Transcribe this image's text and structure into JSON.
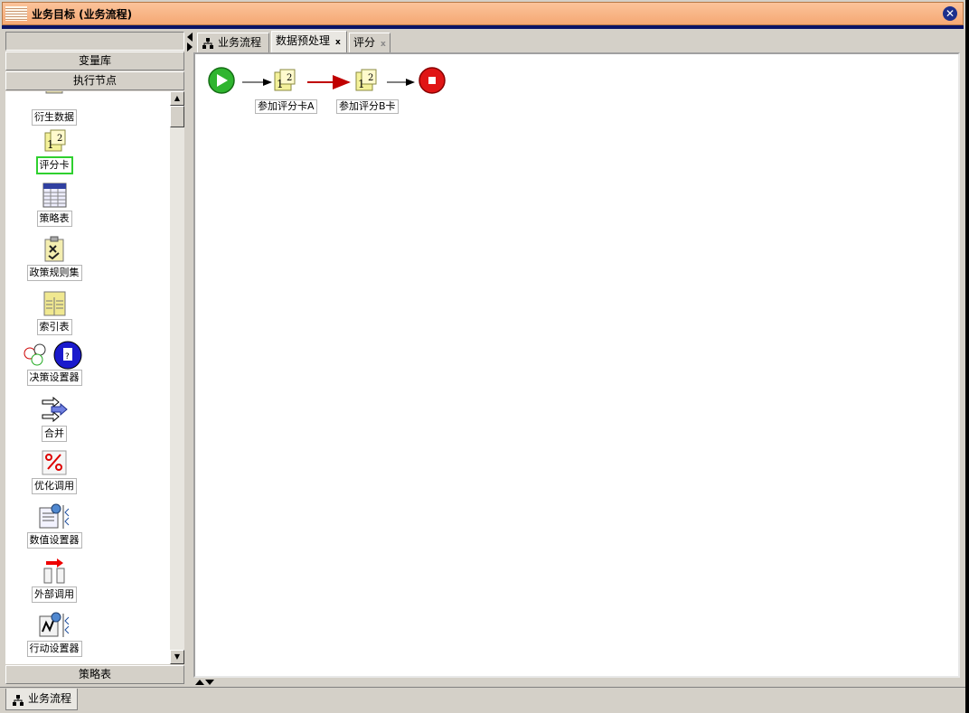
{
  "window": {
    "title": "业务目标 (业务流程)"
  },
  "left_panel": {
    "section_vars": "变量库",
    "section_exec": "执行节点",
    "section_strategy": "策略表",
    "items": [
      {
        "label": "衍生数据",
        "icon": "derived-data-icon"
      },
      {
        "label": "评分卡",
        "icon": "scorecard-icon",
        "selected": true
      },
      {
        "label": "策略表",
        "icon": "strategy-table-icon"
      },
      {
        "label": "政策规则集",
        "icon": "policy-ruleset-icon"
      },
      {
        "label": "索引表",
        "icon": "index-table-icon"
      },
      {
        "label": "决策设置器",
        "icon": "decision-setter-icon"
      },
      {
        "label": "合并",
        "icon": "merge-icon"
      },
      {
        "label": "优化调用",
        "icon": "optimize-call-icon"
      },
      {
        "label": "数值设置器",
        "icon": "value-setter-icon"
      },
      {
        "label": "外部调用",
        "icon": "external-call-icon"
      },
      {
        "label": "行动设置器",
        "icon": "action-setter-icon"
      }
    ]
  },
  "tabs": [
    {
      "label": "业务流程",
      "closable": false
    },
    {
      "label": "数据预处理",
      "closable": true,
      "active": true
    },
    {
      "label": "评分",
      "closable": true
    }
  ],
  "flow": {
    "nodes": [
      {
        "type": "start"
      },
      {
        "type": "scorecard",
        "label": "参加评分卡A"
      },
      {
        "type": "scorecard",
        "label": "参加评分B卡"
      },
      {
        "type": "end"
      }
    ],
    "colors": {
      "start": "#2fb52f",
      "end": "#e01515",
      "highlight_edge": "#c00000",
      "edge": "#000000"
    }
  },
  "bottom_tab": {
    "label": "业务流程"
  }
}
